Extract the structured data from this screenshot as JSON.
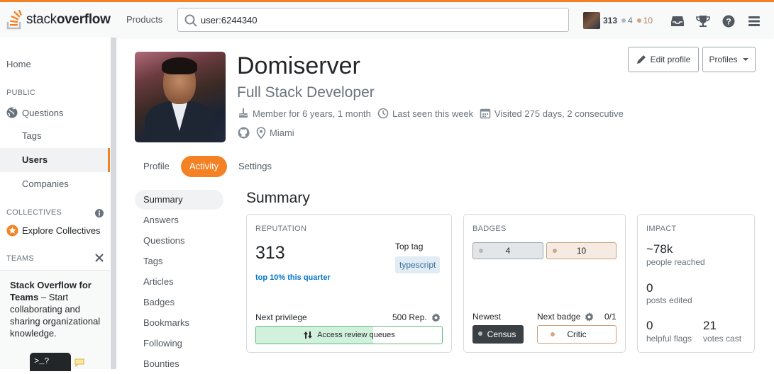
{
  "header": {
    "logo_plain": "stack",
    "logo_bold": "overflow",
    "products": "Products",
    "search_value": "user:6244340",
    "reputation": "313",
    "silver_count": "4",
    "bronze_count": "10"
  },
  "sidebar": {
    "home": "Home",
    "public_head": "PUBLIC",
    "questions": "Questions",
    "tags": "Tags",
    "users": "Users",
    "companies": "Companies",
    "collectives_head": "COLLECTIVES",
    "explore_collectives": "Explore Collectives",
    "teams_head": "TEAMS",
    "teams_bold": "Stack Overflow for Teams",
    "teams_rest": " – Start collaborating and sharing organizational knowledge.",
    "terminal_glyph": ">_?"
  },
  "profile": {
    "name": "Domiserver",
    "title": "Full Stack Developer",
    "member_for": "Member for 6 years, 1 month",
    "last_seen": "Last seen this week",
    "visited": "Visited 275 days, 2 consecutive",
    "location": "Miami",
    "edit_profile": "Edit profile",
    "profiles": "Profiles"
  },
  "tabs": [
    "Profile",
    "Activity",
    "Settings"
  ],
  "subnav": [
    "Summary",
    "Answers",
    "Questions",
    "Tags",
    "Articles",
    "Badges",
    "Bookmarks",
    "Following",
    "Bounties"
  ],
  "summary": {
    "heading": "Summary",
    "reputation": {
      "label": "REPUTATION",
      "value": "313",
      "top": "top 10% this quarter",
      "top_tag_label": "Top tag",
      "top_tag": "typescript",
      "next_priv": "Next privilege",
      "next_priv_rep": "500 Rep.",
      "priv_name": "Access review queues",
      "progress": 0.63
    },
    "badges": {
      "label": "BADGES",
      "silver": "4",
      "bronze": "10",
      "newest": "Newest",
      "newest_badge": "Census",
      "next_badge": "Next badge",
      "next_count": "0/1",
      "next_badge_name": "Critic"
    },
    "impact": {
      "label": "IMPACT",
      "reached": "~78k",
      "reached_label": "people reached",
      "edited": "0",
      "edited_label": "posts edited",
      "flags": "0",
      "flags_label": "helpful flags",
      "votes": "21",
      "votes_label": "votes cast"
    }
  },
  "colors": {
    "accent": "#f48225",
    "link": "#0074cc",
    "silver": "#b4b8bc",
    "bronze": "#d1a684"
  }
}
